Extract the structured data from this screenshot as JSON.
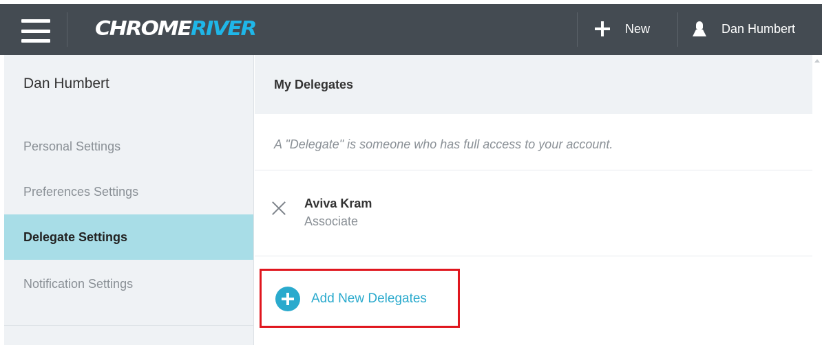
{
  "header": {
    "logo_part1": "CHROME",
    "logo_part2": "RIVER",
    "new_label": "New",
    "user_name": "Dan Humbert",
    "colors": {
      "bar": "#444b52",
      "logo_accent": "#1fb6e8"
    }
  },
  "sidebar": {
    "user_name": "Dan Humbert",
    "items": [
      {
        "label": "Personal Settings",
        "active": false
      },
      {
        "label": "Preferences Settings",
        "active": false
      },
      {
        "label": "Delegate Settings",
        "active": true
      },
      {
        "label": "Notification Settings",
        "active": false
      }
    ],
    "active_color": "#a8dde7"
  },
  "main": {
    "title": "My Delegates",
    "description": "A \"Delegate\" is someone who has full access to your account.",
    "delegates": [
      {
        "name": "Aviva Kram",
        "role": "Associate"
      }
    ],
    "add_label": "Add New Delegates",
    "accent_color": "#2aaacd",
    "highlight_color": "#e0161e"
  },
  "icons": [
    "hamburger-menu-icon",
    "plus-icon",
    "user-icon",
    "remove-icon",
    "add-circle-icon",
    "scroll-up-arrow-icon"
  ]
}
